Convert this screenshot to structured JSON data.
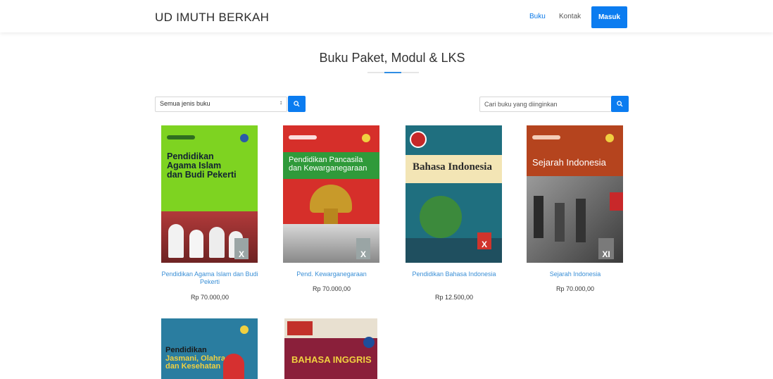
{
  "header": {
    "brand": "UD IMUTH BERKAH",
    "nav": [
      {
        "label": "Buku"
      },
      {
        "label": "Kontak"
      }
    ],
    "login_label": "Masuk"
  },
  "main": {
    "title": "Buku Paket, Modul & LKS",
    "filter": {
      "selected": "Semua jenis buku"
    },
    "search": {
      "placeholder": "Cari buku yang diinginkan"
    },
    "books": [
      {
        "title": "Pendidikan Agama Islam dan Budi Pekerti",
        "price": "Rp 70.000,00",
        "cover_text": [
          "Pendidikan",
          "Agama Islam",
          "dan Budi Pekerti"
        ],
        "grade": "X",
        "cover_color": "#7ed321"
      },
      {
        "title": "Pend. Kewarganegaraan",
        "price": "Rp 70.000,00",
        "cover_text": [
          "Pendidikan Pancasila",
          "dan Kewarganegaraan"
        ],
        "grade": "X",
        "cover_color": "#d62f2a"
      },
      {
        "title": "Pendidikan Bahasa Indonesia",
        "price": "Rp 12.500,00",
        "cover_text": [
          "Bahasa Indonesia"
        ],
        "grade": "X",
        "cover_color": "#1f6f7f"
      },
      {
        "title": "Sejarah Indonesia",
        "price": "Rp 70.000,00",
        "cover_text": [
          "Sejarah Indonesia"
        ],
        "grade": "XI",
        "cover_color": "#b5441e"
      },
      {
        "title": "",
        "price": "",
        "cover_text": [
          "Pendidikan",
          "Jasmani, Olahraga",
          "dan Kesehatan"
        ],
        "grade": "",
        "cover_color": "#2a7da0"
      },
      {
        "title": "",
        "price": "",
        "cover_text": [
          "BAHASA INGGRIS"
        ],
        "grade": "",
        "cover_color": "#8a1f3a"
      }
    ]
  },
  "colors": {
    "accent": "#0b7cf0",
    "link": "#3a8fd6"
  }
}
